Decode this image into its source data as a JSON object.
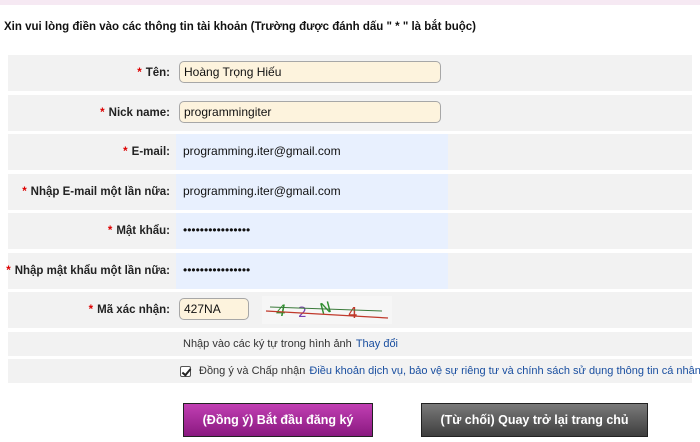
{
  "intro_text": "Xin vui lòng điền vào các thông tin tài khoản (Trường được đánh dấu \" * \" là bắt buộc)",
  "required_mark": "*",
  "fields": {
    "name": {
      "label": "Tên:",
      "value": "Hoàng Trọng Hiếu"
    },
    "nickname": {
      "label": "Nick name:",
      "value": "programmingiter"
    },
    "email": {
      "label": "E-mail:",
      "value": "programming.iter@gmail.com"
    },
    "email_confirm": {
      "label": "Nhập E-mail một lần nữa:",
      "value": "programming.iter@gmail.com"
    },
    "password": {
      "label": "Mật khẩu:",
      "value": "••••••••••••••••"
    },
    "password_confirm": {
      "label": "Nhập mật khẩu một lần nữa:",
      "value": "••••••••••••••••"
    },
    "captcha": {
      "label": "Mã xác nhận:",
      "value": "427NA",
      "image_text": "4 2 N 4"
    }
  },
  "captcha_hint": {
    "text": "Nhập vào các ký tự trong hình ảnh",
    "link": "Thay đổi"
  },
  "agreement": {
    "prefix": "Đồng ý và Chấp nhận",
    "link": "Điều khoản dịch vụ, bảo vệ sự riêng tư và chính sách sử dụng thông tin cá nhân!",
    "checked": true
  },
  "buttons": {
    "submit": "(Đồng ý) Bắt đầu đăng ký",
    "cancel": "(Từ chối) Quay trở lại trang chủ"
  },
  "colors": {
    "required": "#dd0000",
    "input_bg": "#fdf3dd",
    "autofill_bg": "#e8f0fe",
    "primary_button": "#a22a96",
    "secondary_button": "#555555",
    "link": "#1a4fa0"
  }
}
